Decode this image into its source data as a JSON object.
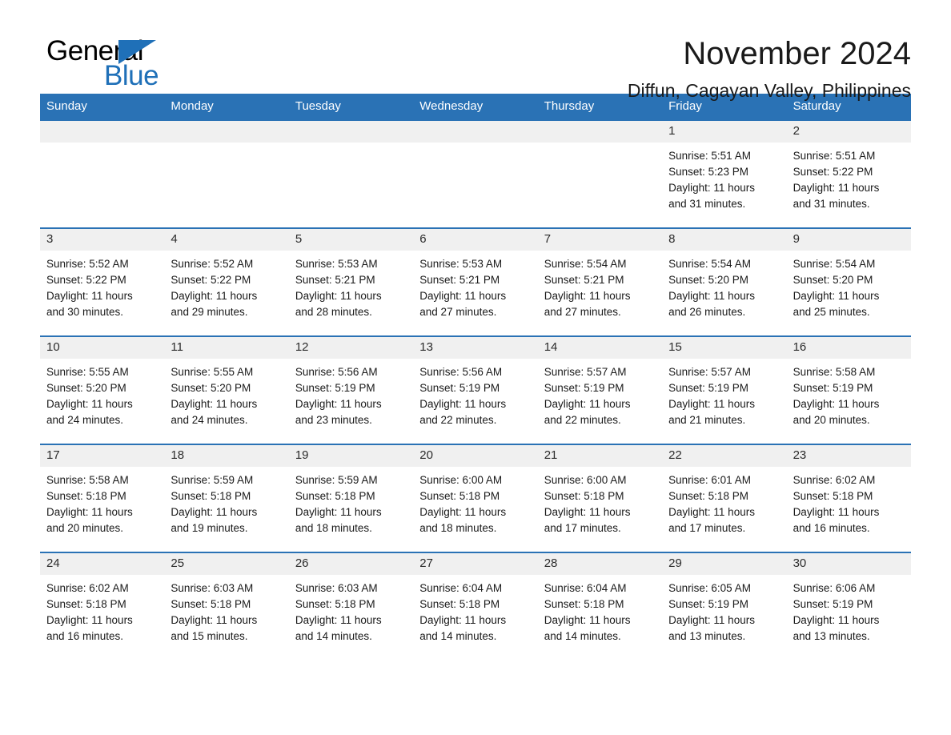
{
  "brand": {
    "name_part1": "General",
    "name_part2": "Blue",
    "triangle_icon": "blue-triangle-logo-mark",
    "color_black": "#000000",
    "color_blue": "#1f70b8"
  },
  "header": {
    "title": "November 2024",
    "location": "Diffun, Cagayan Valley, Philippines"
  },
  "theme": {
    "header_band": "#2a72b5",
    "date_band": "#f0f0f0",
    "text": "#1a1a1a"
  },
  "calendar": {
    "weekdays": [
      "Sunday",
      "Monday",
      "Tuesday",
      "Wednesday",
      "Thursday",
      "Friday",
      "Saturday"
    ],
    "weeks": [
      [
        {
          "day": "",
          "lines": []
        },
        {
          "day": "",
          "lines": []
        },
        {
          "day": "",
          "lines": []
        },
        {
          "day": "",
          "lines": []
        },
        {
          "day": "",
          "lines": []
        },
        {
          "day": "1",
          "lines": [
            "Sunrise: 5:51 AM",
            "Sunset: 5:23 PM",
            "Daylight: 11 hours",
            "and 31 minutes."
          ]
        },
        {
          "day": "2",
          "lines": [
            "Sunrise: 5:51 AM",
            "Sunset: 5:22 PM",
            "Daylight: 11 hours",
            "and 31 minutes."
          ]
        }
      ],
      [
        {
          "day": "3",
          "lines": [
            "Sunrise: 5:52 AM",
            "Sunset: 5:22 PM",
            "Daylight: 11 hours",
            "and 30 minutes."
          ]
        },
        {
          "day": "4",
          "lines": [
            "Sunrise: 5:52 AM",
            "Sunset: 5:22 PM",
            "Daylight: 11 hours",
            "and 29 minutes."
          ]
        },
        {
          "day": "5",
          "lines": [
            "Sunrise: 5:53 AM",
            "Sunset: 5:21 PM",
            "Daylight: 11 hours",
            "and 28 minutes."
          ]
        },
        {
          "day": "6",
          "lines": [
            "Sunrise: 5:53 AM",
            "Sunset: 5:21 PM",
            "Daylight: 11 hours",
            "and 27 minutes."
          ]
        },
        {
          "day": "7",
          "lines": [
            "Sunrise: 5:54 AM",
            "Sunset: 5:21 PM",
            "Daylight: 11 hours",
            "and 27 minutes."
          ]
        },
        {
          "day": "8",
          "lines": [
            "Sunrise: 5:54 AM",
            "Sunset: 5:20 PM",
            "Daylight: 11 hours",
            "and 26 minutes."
          ]
        },
        {
          "day": "9",
          "lines": [
            "Sunrise: 5:54 AM",
            "Sunset: 5:20 PM",
            "Daylight: 11 hours",
            "and 25 minutes."
          ]
        }
      ],
      [
        {
          "day": "10",
          "lines": [
            "Sunrise: 5:55 AM",
            "Sunset: 5:20 PM",
            "Daylight: 11 hours",
            "and 24 minutes."
          ]
        },
        {
          "day": "11",
          "lines": [
            "Sunrise: 5:55 AM",
            "Sunset: 5:20 PM",
            "Daylight: 11 hours",
            "and 24 minutes."
          ]
        },
        {
          "day": "12",
          "lines": [
            "Sunrise: 5:56 AM",
            "Sunset: 5:19 PM",
            "Daylight: 11 hours",
            "and 23 minutes."
          ]
        },
        {
          "day": "13",
          "lines": [
            "Sunrise: 5:56 AM",
            "Sunset: 5:19 PM",
            "Daylight: 11 hours",
            "and 22 minutes."
          ]
        },
        {
          "day": "14",
          "lines": [
            "Sunrise: 5:57 AM",
            "Sunset: 5:19 PM",
            "Daylight: 11 hours",
            "and 22 minutes."
          ]
        },
        {
          "day": "15",
          "lines": [
            "Sunrise: 5:57 AM",
            "Sunset: 5:19 PM",
            "Daylight: 11 hours",
            "and 21 minutes."
          ]
        },
        {
          "day": "16",
          "lines": [
            "Sunrise: 5:58 AM",
            "Sunset: 5:19 PM",
            "Daylight: 11 hours",
            "and 20 minutes."
          ]
        }
      ],
      [
        {
          "day": "17",
          "lines": [
            "Sunrise: 5:58 AM",
            "Sunset: 5:18 PM",
            "Daylight: 11 hours",
            "and 20 minutes."
          ]
        },
        {
          "day": "18",
          "lines": [
            "Sunrise: 5:59 AM",
            "Sunset: 5:18 PM",
            "Daylight: 11 hours",
            "and 19 minutes."
          ]
        },
        {
          "day": "19",
          "lines": [
            "Sunrise: 5:59 AM",
            "Sunset: 5:18 PM",
            "Daylight: 11 hours",
            "and 18 minutes."
          ]
        },
        {
          "day": "20",
          "lines": [
            "Sunrise: 6:00 AM",
            "Sunset: 5:18 PM",
            "Daylight: 11 hours",
            "and 18 minutes."
          ]
        },
        {
          "day": "21",
          "lines": [
            "Sunrise: 6:00 AM",
            "Sunset: 5:18 PM",
            "Daylight: 11 hours",
            "and 17 minutes."
          ]
        },
        {
          "day": "22",
          "lines": [
            "Sunrise: 6:01 AM",
            "Sunset: 5:18 PM",
            "Daylight: 11 hours",
            "and 17 minutes."
          ]
        },
        {
          "day": "23",
          "lines": [
            "Sunrise: 6:02 AM",
            "Sunset: 5:18 PM",
            "Daylight: 11 hours",
            "and 16 minutes."
          ]
        }
      ],
      [
        {
          "day": "24",
          "lines": [
            "Sunrise: 6:02 AM",
            "Sunset: 5:18 PM",
            "Daylight: 11 hours",
            "and 16 minutes."
          ]
        },
        {
          "day": "25",
          "lines": [
            "Sunrise: 6:03 AM",
            "Sunset: 5:18 PM",
            "Daylight: 11 hours",
            "and 15 minutes."
          ]
        },
        {
          "day": "26",
          "lines": [
            "Sunrise: 6:03 AM",
            "Sunset: 5:18 PM",
            "Daylight: 11 hours",
            "and 14 minutes."
          ]
        },
        {
          "day": "27",
          "lines": [
            "Sunrise: 6:04 AM",
            "Sunset: 5:18 PM",
            "Daylight: 11 hours",
            "and 14 minutes."
          ]
        },
        {
          "day": "28",
          "lines": [
            "Sunrise: 6:04 AM",
            "Sunset: 5:18 PM",
            "Daylight: 11 hours",
            "and 14 minutes."
          ]
        },
        {
          "day": "29",
          "lines": [
            "Sunrise: 6:05 AM",
            "Sunset: 5:19 PM",
            "Daylight: 11 hours",
            "and 13 minutes."
          ]
        },
        {
          "day": "30",
          "lines": [
            "Sunrise: 6:06 AM",
            "Sunset: 5:19 PM",
            "Daylight: 11 hours",
            "and 13 minutes."
          ]
        }
      ]
    ]
  }
}
